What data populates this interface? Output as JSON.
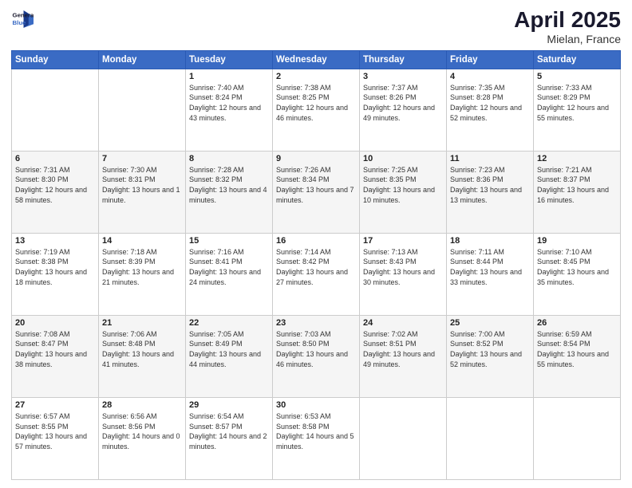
{
  "header": {
    "logo_line1": "General",
    "logo_line2": "Blue",
    "title": "April 2025",
    "subtitle": "Mielan, France"
  },
  "days_of_week": [
    "Sunday",
    "Monday",
    "Tuesday",
    "Wednesday",
    "Thursday",
    "Friday",
    "Saturday"
  ],
  "weeks": [
    [
      {
        "day": "",
        "info": ""
      },
      {
        "day": "",
        "info": ""
      },
      {
        "day": "1",
        "info": "Sunrise: 7:40 AM\nSunset: 8:24 PM\nDaylight: 12 hours and 43 minutes."
      },
      {
        "day": "2",
        "info": "Sunrise: 7:38 AM\nSunset: 8:25 PM\nDaylight: 12 hours and 46 minutes."
      },
      {
        "day": "3",
        "info": "Sunrise: 7:37 AM\nSunset: 8:26 PM\nDaylight: 12 hours and 49 minutes."
      },
      {
        "day": "4",
        "info": "Sunrise: 7:35 AM\nSunset: 8:28 PM\nDaylight: 12 hours and 52 minutes."
      },
      {
        "day": "5",
        "info": "Sunrise: 7:33 AM\nSunset: 8:29 PM\nDaylight: 12 hours and 55 minutes."
      }
    ],
    [
      {
        "day": "6",
        "info": "Sunrise: 7:31 AM\nSunset: 8:30 PM\nDaylight: 12 hours and 58 minutes."
      },
      {
        "day": "7",
        "info": "Sunrise: 7:30 AM\nSunset: 8:31 PM\nDaylight: 13 hours and 1 minute."
      },
      {
        "day": "8",
        "info": "Sunrise: 7:28 AM\nSunset: 8:32 PM\nDaylight: 13 hours and 4 minutes."
      },
      {
        "day": "9",
        "info": "Sunrise: 7:26 AM\nSunset: 8:34 PM\nDaylight: 13 hours and 7 minutes."
      },
      {
        "day": "10",
        "info": "Sunrise: 7:25 AM\nSunset: 8:35 PM\nDaylight: 13 hours and 10 minutes."
      },
      {
        "day": "11",
        "info": "Sunrise: 7:23 AM\nSunset: 8:36 PM\nDaylight: 13 hours and 13 minutes."
      },
      {
        "day": "12",
        "info": "Sunrise: 7:21 AM\nSunset: 8:37 PM\nDaylight: 13 hours and 16 minutes."
      }
    ],
    [
      {
        "day": "13",
        "info": "Sunrise: 7:19 AM\nSunset: 8:38 PM\nDaylight: 13 hours and 18 minutes."
      },
      {
        "day": "14",
        "info": "Sunrise: 7:18 AM\nSunset: 8:39 PM\nDaylight: 13 hours and 21 minutes."
      },
      {
        "day": "15",
        "info": "Sunrise: 7:16 AM\nSunset: 8:41 PM\nDaylight: 13 hours and 24 minutes."
      },
      {
        "day": "16",
        "info": "Sunrise: 7:14 AM\nSunset: 8:42 PM\nDaylight: 13 hours and 27 minutes."
      },
      {
        "day": "17",
        "info": "Sunrise: 7:13 AM\nSunset: 8:43 PM\nDaylight: 13 hours and 30 minutes."
      },
      {
        "day": "18",
        "info": "Sunrise: 7:11 AM\nSunset: 8:44 PM\nDaylight: 13 hours and 33 minutes."
      },
      {
        "day": "19",
        "info": "Sunrise: 7:10 AM\nSunset: 8:45 PM\nDaylight: 13 hours and 35 minutes."
      }
    ],
    [
      {
        "day": "20",
        "info": "Sunrise: 7:08 AM\nSunset: 8:47 PM\nDaylight: 13 hours and 38 minutes."
      },
      {
        "day": "21",
        "info": "Sunrise: 7:06 AM\nSunset: 8:48 PM\nDaylight: 13 hours and 41 minutes."
      },
      {
        "day": "22",
        "info": "Sunrise: 7:05 AM\nSunset: 8:49 PM\nDaylight: 13 hours and 44 minutes."
      },
      {
        "day": "23",
        "info": "Sunrise: 7:03 AM\nSunset: 8:50 PM\nDaylight: 13 hours and 46 minutes."
      },
      {
        "day": "24",
        "info": "Sunrise: 7:02 AM\nSunset: 8:51 PM\nDaylight: 13 hours and 49 minutes."
      },
      {
        "day": "25",
        "info": "Sunrise: 7:00 AM\nSunset: 8:52 PM\nDaylight: 13 hours and 52 minutes."
      },
      {
        "day": "26",
        "info": "Sunrise: 6:59 AM\nSunset: 8:54 PM\nDaylight: 13 hours and 55 minutes."
      }
    ],
    [
      {
        "day": "27",
        "info": "Sunrise: 6:57 AM\nSunset: 8:55 PM\nDaylight: 13 hours and 57 minutes."
      },
      {
        "day": "28",
        "info": "Sunrise: 6:56 AM\nSunset: 8:56 PM\nDaylight: 14 hours and 0 minutes."
      },
      {
        "day": "29",
        "info": "Sunrise: 6:54 AM\nSunset: 8:57 PM\nDaylight: 14 hours and 2 minutes."
      },
      {
        "day": "30",
        "info": "Sunrise: 6:53 AM\nSunset: 8:58 PM\nDaylight: 14 hours and 5 minutes."
      },
      {
        "day": "",
        "info": ""
      },
      {
        "day": "",
        "info": ""
      },
      {
        "day": "",
        "info": ""
      }
    ]
  ]
}
